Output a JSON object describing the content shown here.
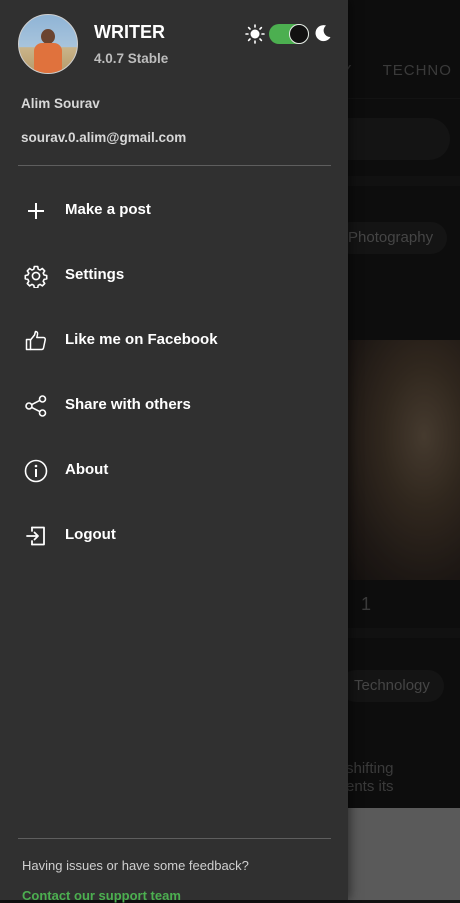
{
  "background": {
    "tabs": [
      "RY",
      "TECHNO"
    ],
    "chips": [
      "Photography",
      "Technology"
    ],
    "count": "1",
    "snippet": "shifting\nents its"
  },
  "drawer": {
    "app_title": "WRITER",
    "version": "4.0.7 Stable",
    "theme_toggle": {
      "dark_mode": true,
      "accent": "#4caf50"
    },
    "user": {
      "name": "Alim Sourav",
      "email": "sourav.0.alim@gmail.com"
    },
    "menu": [
      {
        "label": "Make a post",
        "icon": "plus-icon"
      },
      {
        "label": "Settings",
        "icon": "gear-icon"
      },
      {
        "label": "Like me on Facebook",
        "icon": "thumbs-up-icon"
      },
      {
        "label": "Share with others",
        "icon": "share-icon"
      },
      {
        "label": "About",
        "icon": "info-icon"
      },
      {
        "label": "Logout",
        "icon": "logout-icon"
      }
    ],
    "footer": {
      "feedback_text": "Having issues or have some feedback?",
      "support_link": "Contact our support team"
    }
  },
  "colors": {
    "drawer_bg": "#303030",
    "accent": "#4caf50",
    "text": "#ffffff"
  }
}
